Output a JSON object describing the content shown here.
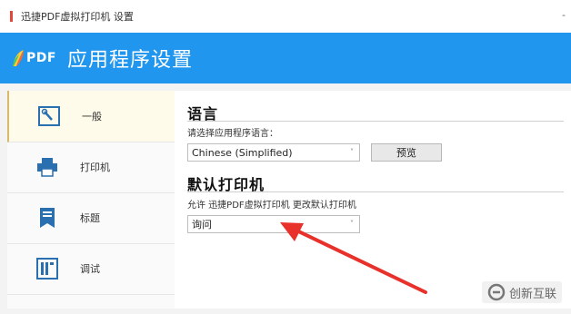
{
  "window": {
    "title": "迅捷PDF虚拟打印机 设置"
  },
  "header": {
    "logo_text": "PDF",
    "title": "应用程序设置"
  },
  "sidebar": {
    "items": [
      {
        "label": "一般",
        "icon": "settings-wrench-icon"
      },
      {
        "label": "打印机",
        "icon": "printer-icon"
      },
      {
        "label": "标题",
        "icon": "bookmark-icon"
      },
      {
        "label": "调试",
        "icon": "debug-icon"
      }
    ]
  },
  "language": {
    "title": "语言",
    "hint": "请选择应用程序语言：",
    "selected": "Chinese (Simplified)",
    "preview_button": "预览"
  },
  "default_printer": {
    "title": "默认打印机",
    "hint": "允许 迅捷PDF虚拟打印机 更改默认打印机",
    "selected": "询问"
  },
  "watermark": {
    "text": "创新互联"
  },
  "colors": {
    "banner": "#2196ee",
    "arrow": "#e8312b"
  }
}
